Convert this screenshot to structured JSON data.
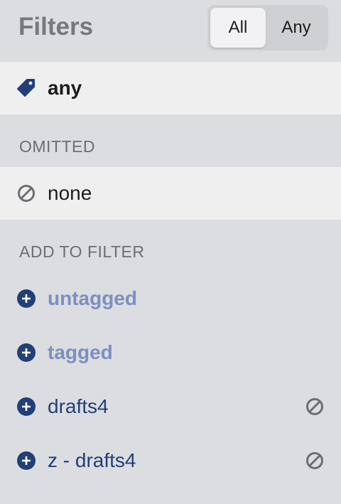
{
  "header": {
    "title": "Filters",
    "segment_all": "All",
    "segment_any": "Any"
  },
  "active_row": {
    "label": "any",
    "icon": "tag-icon"
  },
  "omitted": {
    "heading": "OMITTED",
    "items": [
      {
        "label": "none",
        "icon": "prohibit-icon"
      }
    ]
  },
  "add_to_filter": {
    "heading": "ADD TO FILTER",
    "items": [
      {
        "label": "untagged",
        "icon": "plus-circle-icon"
      },
      {
        "label": "tagged",
        "icon": "plus-circle-icon"
      },
      {
        "label": "drafts4",
        "icon": "plus-circle-icon",
        "trailing_icon": "prohibit-icon"
      },
      {
        "label": "z - drafts4",
        "icon": "plus-circle-icon",
        "trailing_icon": "prohibit-icon"
      }
    ]
  },
  "colors": {
    "accent_navy": "#223f78",
    "muted_blue": "#7c8fbf",
    "background": "#dcdde0",
    "row_highlight": "#efeff0"
  }
}
